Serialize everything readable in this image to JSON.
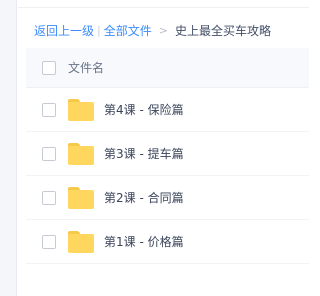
{
  "breadcrumb": {
    "back_label": "返回上一级",
    "separator": "|",
    "all_files_label": "全部文件",
    "arrow": ">",
    "current_label": "史上最全买车攻略"
  },
  "list": {
    "header_label": "文件名",
    "items": [
      {
        "name": "第4课 - 保险篇",
        "icon": "folder-icon"
      },
      {
        "name": "第3课 - 提车篇",
        "icon": "folder-icon"
      },
      {
        "name": "第2课 - 合同篇",
        "icon": "folder-icon"
      },
      {
        "name": "第1课 - 价格篇",
        "icon": "folder-icon"
      }
    ]
  },
  "colors": {
    "link": "#3b8cff",
    "folder": "#ffd75e",
    "header_bg": "#f7f9fc"
  }
}
